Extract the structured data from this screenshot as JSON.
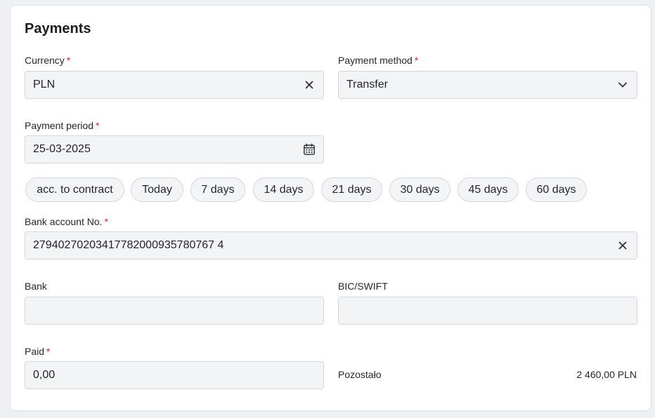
{
  "section": {
    "title": "Payments"
  },
  "currency": {
    "label": "Currency",
    "required_mark": "*",
    "value": "PLN"
  },
  "payment_method": {
    "label": "Payment method",
    "required_mark": "*",
    "value": "Transfer"
  },
  "payment_period": {
    "label": "Payment period",
    "required_mark": "*",
    "value": "25-03-2025"
  },
  "period_chips": [
    "acc. to contract",
    "Today",
    "7 days",
    "14 days",
    "21 days",
    "30 days",
    "45 days",
    "60 days"
  ],
  "bank_account": {
    "label": "Bank account No.",
    "required_mark": "*",
    "value": "27940270203417782000935780767 4"
  },
  "bank": {
    "label": "Bank",
    "value": ""
  },
  "bic": {
    "label": "BIC/SWIFT",
    "value": ""
  },
  "paid": {
    "label": "Paid",
    "required_mark": "*",
    "value": "0,00"
  },
  "remaining": {
    "label": "Pozostało",
    "value": "2 460,00 PLN"
  },
  "colors": {
    "required": "#d6203a",
    "field_bg": "#f3f4f6",
    "border": "#d3d6db",
    "page_bg": "#eef0f3"
  },
  "icons": {
    "clear": "close-icon",
    "dropdown": "chevron-down-icon",
    "calendar": "calendar-icon"
  }
}
